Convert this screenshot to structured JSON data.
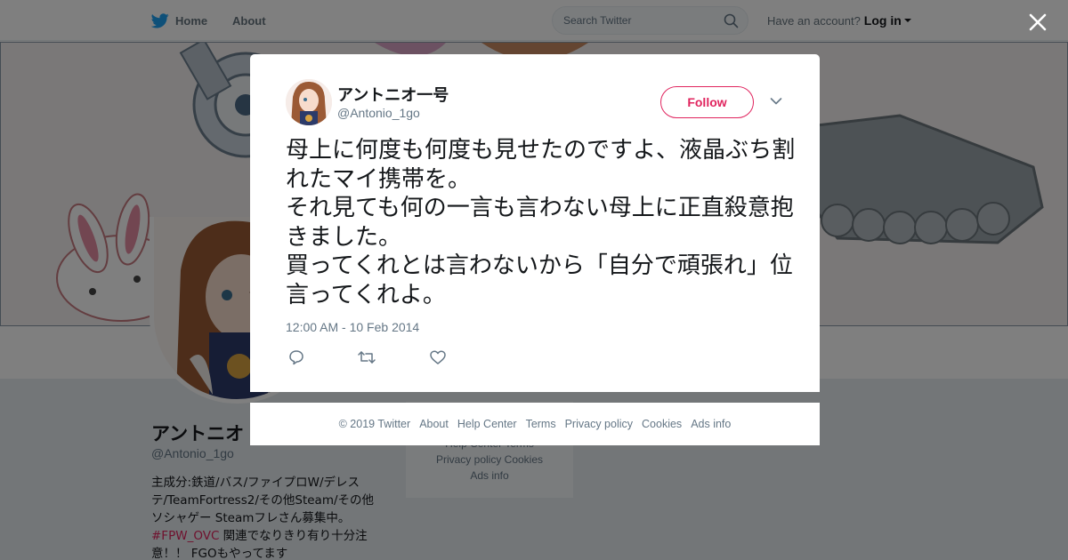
{
  "nav": {
    "home_label": "Home",
    "about_label": "About",
    "search_placeholder": "Search Twitter",
    "account_prompt": "Have an account?",
    "login_label": "Log in"
  },
  "profile": {
    "name": "アントニオ",
    "handle": "@Antonio_1go",
    "bio_lines": [
      "主成分:鉄道/バス/ファイプロW/デレス",
      "テ/TeamFortress2/その他Steam/その他",
      "ソシャゲー Steamフレさん募集中。"
    ],
    "bio_hashtag": "#FPW_OVC",
    "bio_after_hashtag": " 関連でなりきり有り十分注",
    "bio_last_line": "意！！ FGOもやってます"
  },
  "background_footer": {
    "row1": "Help Center   Terms",
    "row2": "Privacy policy   Cookies",
    "row3": "Ads info"
  },
  "tweet": {
    "author_name": "アントニオ一号",
    "author_handle": "@Antonio_1go",
    "follow_label": "Follow",
    "text": "母上に何度も何度も見せたのですよ、液晶ぶち割れたマイ携帯を。\nそれ見ても何の一言も言わない母上に正直殺意抱きました。\n買ってくれとは言わないから「自分で頑張れ」位言ってくれよ。",
    "timestamp": "12:00 AM - 10 Feb 2014"
  },
  "footer": {
    "copyright": "© 2019 Twitter",
    "links": [
      "About",
      "Help Center",
      "Terms",
      "Privacy policy",
      "Cookies",
      "Ads info"
    ]
  },
  "colors": {
    "brand_blue": "#1da1f2",
    "accent_pink": "#e0245e",
    "muted_text": "#657786"
  },
  "icons": {
    "logo": "twitter-bird-icon",
    "search": "search-icon",
    "close": "close-icon",
    "menu": "chevron-down-icon",
    "reply": "reply-icon",
    "retweet": "retweet-icon",
    "like": "heart-icon"
  }
}
